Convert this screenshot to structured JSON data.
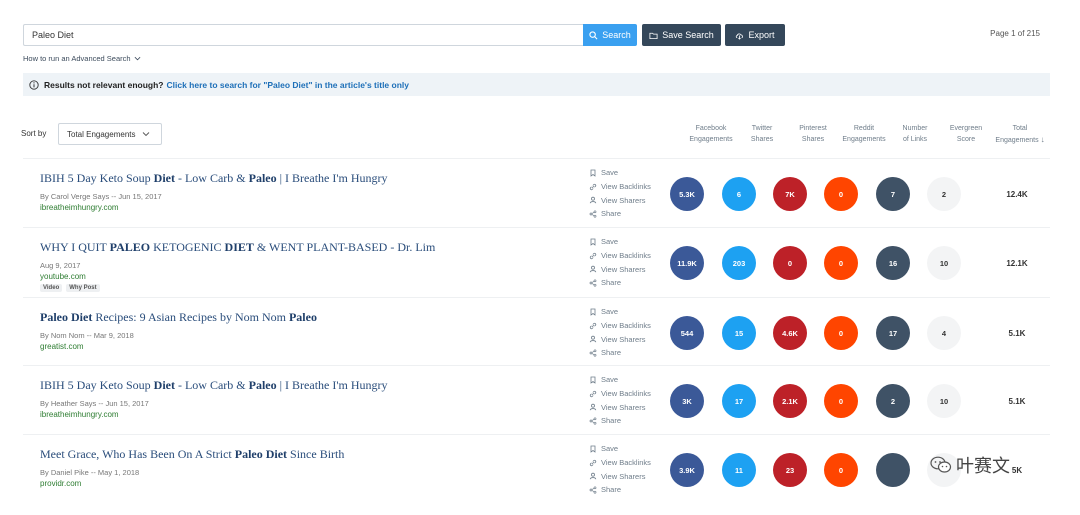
{
  "search": {
    "value": "Paleo Diet",
    "button": "Search"
  },
  "toolbar": {
    "save_search": "Save Search",
    "export": "Export"
  },
  "pagination": {
    "text": "Page 1 of 215"
  },
  "advanced_link": "How to run an Advanced Search",
  "notice": {
    "prefix": "Results not relevant enough?",
    "link": "Click here to search for \"Paleo Diet\" in the article's title only"
  },
  "sort": {
    "label": "Sort by",
    "value": "Total Engagements"
  },
  "columns": [
    {
      "l1": "Facebook",
      "l2": "Engagements"
    },
    {
      "l1": "Twitter",
      "l2": "Shares"
    },
    {
      "l1": "Pinterest",
      "l2": "Shares"
    },
    {
      "l1": "Reddit",
      "l2": "Engagements"
    },
    {
      "l1": "Number",
      "l2": "of Links"
    },
    {
      "l1": "Evergreen",
      "l2": "Score"
    },
    {
      "l1": "Total",
      "l2": "Engagements"
    }
  ],
  "actions": [
    "Save",
    "View Backlinks",
    "View Sharers",
    "Share"
  ],
  "rows": [
    {
      "title_parts": [
        [
          "IBIH 5 Day Keto Soup ",
          false
        ],
        [
          "Diet",
          true
        ],
        [
          " - Low Carb & ",
          false
        ],
        [
          "Paleo",
          true
        ],
        [
          " | I Breathe I'm Hungry",
          false
        ]
      ],
      "meta": "By Carol Verge Says -- Jun 15, 2017",
      "domain": "ibreatheimhungry.com",
      "tags": [],
      "facebook": "5.3K",
      "twitter": "6",
      "pinterest": "7K",
      "reddit": "0",
      "links": "7",
      "evergreen": "2",
      "total": "12.4K"
    },
    {
      "title_parts": [
        [
          "WHY I QUIT ",
          false
        ],
        [
          "PALEO",
          true
        ],
        [
          " KETOGENIC ",
          false
        ],
        [
          "DIET",
          true
        ],
        [
          " & WENT PLANT-BASED - Dr. Lim",
          false
        ]
      ],
      "meta": "Aug 9, 2017",
      "domain": "youtube.com",
      "tags": [
        "Video",
        "Why Post"
      ],
      "facebook": "11.9K",
      "twitter": "203",
      "pinterest": "0",
      "reddit": "0",
      "links": "16",
      "evergreen": "10",
      "total": "12.1K"
    },
    {
      "title_parts": [
        [
          "Paleo Diet",
          true
        ],
        [
          " Recipes: 9 Asian Recipes by Nom Nom ",
          false
        ],
        [
          "Paleo",
          true
        ]
      ],
      "meta": "By Nom Nom -- Mar 9, 2018",
      "domain": "greatist.com",
      "tags": [],
      "facebook": "544",
      "twitter": "15",
      "pinterest": "4.6K",
      "reddit": "0",
      "links": "17",
      "evergreen": "4",
      "total": "5.1K"
    },
    {
      "title_parts": [
        [
          "IBIH 5 Day Keto Soup ",
          false
        ],
        [
          "Diet",
          true
        ],
        [
          " - Low Carb & ",
          false
        ],
        [
          "Paleo",
          true
        ],
        [
          " | I Breathe I'm Hungry",
          false
        ]
      ],
      "meta": "By Heather Says -- Jun 15, 2017",
      "domain": "ibreatheimhungry.com",
      "tags": [],
      "facebook": "3K",
      "twitter": "17",
      "pinterest": "2.1K",
      "reddit": "0",
      "links": "2",
      "evergreen": "10",
      "total": "5.1K"
    },
    {
      "title_parts": [
        [
          "Meet Grace, Who Has Been On A Strict ",
          false
        ],
        [
          "Paleo Diet",
          true
        ],
        [
          " Since Birth",
          false
        ]
      ],
      "meta": "By Daniel Pike -- May 1, 2018",
      "domain": "providr.com",
      "tags": [],
      "facebook": "3.9K",
      "twitter": "11",
      "pinterest": "23",
      "reddit": "0",
      "links": "",
      "evergreen": "",
      "total": "5K"
    }
  ],
  "watermark": {
    "text": "叶赛文"
  },
  "colors": {
    "facebook": "#3b5998",
    "twitter": "#1da1f2",
    "pinterest": "#bd2128",
    "reddit": "#ff4500",
    "links": "#3f5266",
    "search_button": "#3aa0f0",
    "dark_button": "#34475a"
  }
}
